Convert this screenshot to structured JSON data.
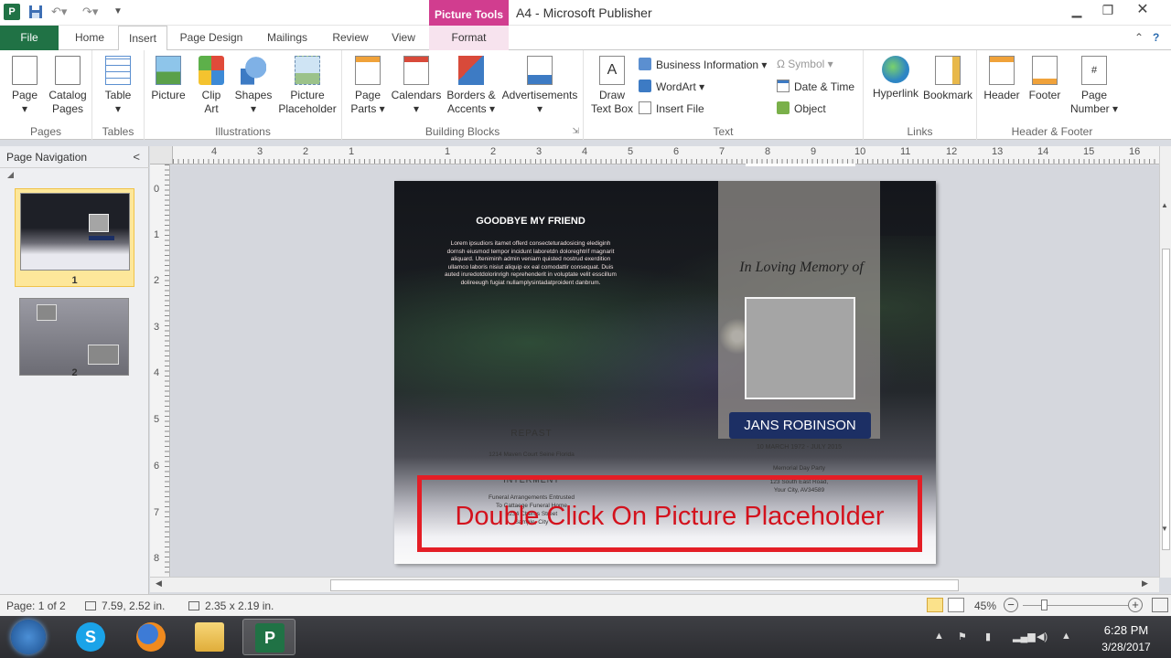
{
  "titlebar": {
    "context_tab": "Picture Tools",
    "window_title": "A4  -  Microsoft Publisher",
    "app_icon_glyph": "P"
  },
  "tabs": [
    {
      "label": "File"
    },
    {
      "label": "Home"
    },
    {
      "label": "Insert"
    },
    {
      "label": "Page Design"
    },
    {
      "label": "Mailings"
    },
    {
      "label": "Review"
    },
    {
      "label": "View"
    },
    {
      "label": "Format"
    }
  ],
  "ribbon": {
    "groups": {
      "pages": "Pages",
      "tables": "Tables",
      "illustrations": "Illustrations",
      "building_blocks": "Building Blocks",
      "text": "Text",
      "links": "Links",
      "header_footer": "Header & Footer"
    },
    "buttons": {
      "page_l1": "Page",
      "catalog_pages_l1": "Catalog",
      "catalog_pages_l2": "Pages",
      "table_l1": "Table",
      "picture_l1": "Picture",
      "clip_art_l1": "Clip",
      "clip_art_l2": "Art",
      "shapes_l1": "Shapes",
      "picture_placeholder_l1": "Picture",
      "picture_placeholder_l2": "Placeholder",
      "page_parts_l1": "Page",
      "page_parts_l2": "Parts ▾",
      "calendars_l1": "Calendars",
      "borders_accents_l1": "Borders &",
      "borders_accents_l2": "Accents ▾",
      "advertisements_l1": "Advertisements",
      "draw_text_box_l1": "Draw",
      "draw_text_box_l2": "Text Box",
      "business_information": "Business Information ▾",
      "wordart": "WordArt ▾",
      "insert_file": "Insert File",
      "symbol": "Ω  Symbol ▾",
      "date_time": "Date & Time",
      "object": "Object",
      "hyperlink_l1": "Hyperlink",
      "bookmark_l1": "Bookmark",
      "header_l1": "Header",
      "footer_l1": "Footer",
      "page_number_l1": "Page",
      "page_number_l2": "Number ▾"
    }
  },
  "nav": {
    "title": "Page Navigation",
    "collapse_glyph": "<",
    "pages": [
      "1",
      "2"
    ]
  },
  "rulers": {
    "horizontal": [
      "4",
      "3",
      "2",
      "1",
      "1",
      "2",
      "3",
      "4",
      "5",
      "6",
      "7",
      "8",
      "9",
      "10",
      "11",
      "12",
      "13",
      "14",
      "15",
      "16"
    ],
    "vertical": [
      "0",
      "1",
      "2",
      "3",
      "4",
      "5",
      "6",
      "7",
      "8"
    ]
  },
  "document": {
    "heading": "GOODBYE MY FRIEND",
    "lorem": "Lorem ipsudiors itamet offerd consecteturadosicing elediginh dornsh eiusmod tempor incidunt laboretdn doloreghtrif magnarit aliquard. Uteniminh admin veniam quisted nostrud exerdition ullamco laboris nisiut aliquip ex eal comodattir consequat. Duis auted iruredotdolorinrigh reprehenderit in voluptate velit esscillum dolireeugh fugiat nullamplysintadatproident danbrum.",
    "memory": "In Loving Memory of",
    "name": "JANS ROBINSON",
    "dates": "10 MARCH 1972 - JULY 2015",
    "memorial_l1": "Memorial Day Party",
    "memorial_l2": "123 South East Road,",
    "memorial_l3": "Your City, AV34589",
    "repast": "REPAST",
    "repast_address": "1214 Maven Court Seine Florida",
    "interment": "INTERMENT",
    "interment_l1": "Funeral Arrangements Entrusted",
    "interment_l2": "To Cattaege Funeral Home",
    "interment_l3": "1234 Cherus Street",
    "interment_l4": "Sample, City"
  },
  "annotation": {
    "text": "Double Click On Picture Placeholder",
    "color": "#e41e26"
  },
  "status": {
    "page": "Page: 1 of 2",
    "position": "7.59, 2.52 in.",
    "size": "2.35 x  2.19 in.",
    "zoom": "45%",
    "zoom_level": 0.45,
    "zoom_out": "−",
    "zoom_in": "+"
  },
  "taskbar": {
    "time": "6:28 PM",
    "date": "3/28/2017",
    "apps": [
      "skype-icon",
      "firefox-icon",
      "file-explorer-icon",
      "publisher-icon"
    ],
    "skype_glyph": "S",
    "publisher_glyph": "P"
  },
  "colors": {
    "file_tab": "#207245",
    "context_tab": "#d13d8f",
    "name_plate": "#1c2f64"
  }
}
